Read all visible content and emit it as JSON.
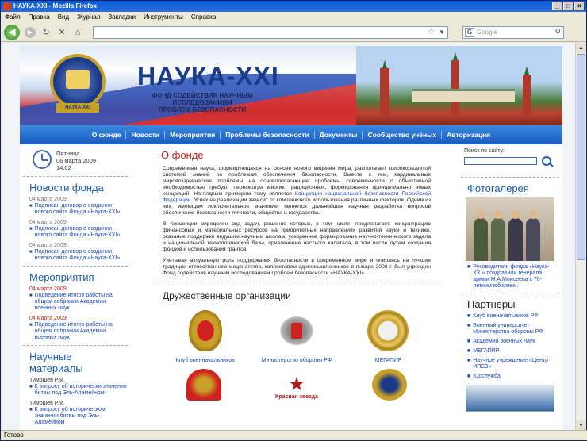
{
  "window": {
    "title": "НАУКА-XXI - Mozilla Firefox",
    "status": "Готово"
  },
  "menu": [
    "Файл",
    "Правка",
    "Вид",
    "Журнал",
    "Закладки",
    "Инструменты",
    "Справка"
  ],
  "browser": {
    "search_placeholder": "Google"
  },
  "header": {
    "title": "НАУКА-XXI",
    "subtitle_line1": "ФОНД СОДЕЙСТВИЯ НАУЧНЫМ ИССЛЕДОВАНИЯМ",
    "subtitle_line2": "ПРОБЛЕМ БЕЗОПАСНОСТИ",
    "emblem_text": "НАУКА-XXI"
  },
  "nav": [
    "О фонде",
    "Новости",
    "Мероприятия",
    "Проблемы безопасности",
    "Документы",
    "Сообщество учёных",
    "Авторизация"
  ],
  "clock": {
    "day": "Пятница",
    "date": "06 марта 2009",
    "time": "14:02"
  },
  "news": {
    "title": "Новости фонда",
    "items": [
      {
        "date": "04 марта 2009",
        "text": "Подписан договор о создании нового сайта Фонда «Наука-XXI»"
      },
      {
        "date": "04 марта 2009",
        "text": "Подписан договор о создании нового сайта Фонда «Наука-XXI»"
      },
      {
        "date": "04 марта 2009",
        "text": "Подписан договор о создании нового сайта Фонда «Наука-XXI»"
      }
    ]
  },
  "events": {
    "title": "Мероприятия",
    "items": [
      {
        "date": "04 марта 2009",
        "text": "Подведение итогов работы на общем собрании Академии военных наук"
      },
      {
        "date": "04 марта 2009",
        "text": "Подведение итогов работы на общем собрании Академии военных наук"
      }
    ]
  },
  "materials": {
    "title": "Научные материалы",
    "items": [
      {
        "author": "Тимошев Р.М.",
        "text": "К вопросу об исторически значении битвы под Эль-Аламейном"
      },
      {
        "author": "Тимошев Р.М.",
        "text": "К вопросу об историческом значении битвы под Эль-Аламейном"
      }
    ]
  },
  "main": {
    "title": "О фонде",
    "p1": "Современная наука, формирующаяся на основе нового видения мира, располагает широкоразвитой системой знаний по проблемам обеспечения безопасности. Вместе с тем, кардинальные мировоззренческие проблемы на основополагающие проблемы современности с объективной необходимостью требуют пересмотра многих традиционных, формирования принципиально новых концепций. Наглядным примером тому является",
    "p1_link": "Концепция национальной безопасности Российской Федерации.",
    "p1_tail": "Успех ее реализации зависит от комплексного использования различных факторов. Одним из них, имеющим исключительное значение, является дальнейшая научная разработка вопросов обеспечения безопасности личности, общества и государства.",
    "p2": "В Концепции определен ряд задач, решение которых, в том числе, предполагает: концентрацию финансовых и материальных ресурсов на приоритетных направлениях развития науки и техники, оказание поддержки ведущим научным школам, ускоренное формирование научно-технического задела и национальной технологической базы, привлечение частного капитала, в том числе путем создания фондов и использования грантов:",
    "p3": "Учитывая актуальную роль поддержания безопасности в современном мире и опираясь на лучшие традиции отечественного меценатства, коллективом единомышленников в январе 2008 г. был учрежден Фонд содействия научным исследованиям проблем безопасности «НАУКА-XXI»."
  },
  "friends": {
    "title": "Дружественные организации",
    "orgs": [
      "Клуб военначальников",
      "Министерство обороны РФ",
      "МЕГАПИР"
    ],
    "bottom_label": "Красная звезда"
  },
  "right": {
    "search_label": "Поиск по сайту:",
    "gallery_title": "Фотогалерея",
    "photo_caption": "Руководители фонда «Наука-XXI» поздравили генерала армии М.А.Моисеева с 70-летним юбилеем.",
    "partners_title": "Партнеры",
    "partners": [
      "Клуб военачальников РФ",
      "Военный университет Министерства обороны РФ",
      "Академия военных наук",
      "МЕГАПИР",
      "Научное учреждение «Центр ИПСЗ»",
      "Юрслужба"
    ]
  },
  "colors": {
    "accent": "#1a5ab8",
    "nav_bg": "#2a72d8",
    "title_red": "#d02020"
  }
}
